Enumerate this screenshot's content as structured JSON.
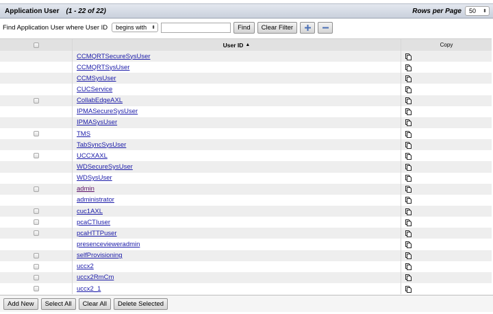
{
  "header": {
    "title": "Application User",
    "count": "(1 - 22 of 22)",
    "rows_per_page_label": "Rows per Page",
    "rows_per_page_value": "50"
  },
  "filter": {
    "label": "Find Application User where User ID",
    "match_value": "begins with",
    "search_value": "",
    "find_label": "Find",
    "clear_filter_label": "Clear Filter",
    "add_icon": "plus-icon",
    "remove_icon": "minus-icon"
  },
  "table": {
    "columns": {
      "user_id": "User ID",
      "sort_indicator": "▲",
      "copy": "Copy"
    },
    "rows": [
      {
        "user_id": "CCMQRTSecureSysUser",
        "checkbox": false,
        "visited": false
      },
      {
        "user_id": "CCMQRTSysUser",
        "checkbox": false,
        "visited": false
      },
      {
        "user_id": "CCMSysUser",
        "checkbox": false,
        "visited": false
      },
      {
        "user_id": "CUCService",
        "checkbox": false,
        "visited": false
      },
      {
        "user_id": "CollabEdgeAXL",
        "checkbox": true,
        "visited": false
      },
      {
        "user_id": "IPMASecureSysUser",
        "checkbox": false,
        "visited": false
      },
      {
        "user_id": "IPMASysUser",
        "checkbox": false,
        "visited": false
      },
      {
        "user_id": "TMS",
        "checkbox": true,
        "visited": false
      },
      {
        "user_id": "TabSyncSysUser",
        "checkbox": false,
        "visited": false
      },
      {
        "user_id": "UCCXAXL",
        "checkbox": true,
        "visited": false
      },
      {
        "user_id": "WDSecureSysUser",
        "checkbox": false,
        "visited": false
      },
      {
        "user_id": "WDSysUser",
        "checkbox": false,
        "visited": false
      },
      {
        "user_id": "admin",
        "checkbox": true,
        "visited": true
      },
      {
        "user_id": "administrator",
        "checkbox": false,
        "visited": false
      },
      {
        "user_id": "cuc1AXL",
        "checkbox": true,
        "visited": false
      },
      {
        "user_id": "pcaCTIuser",
        "checkbox": true,
        "visited": false
      },
      {
        "user_id": "pcaHTTPuser",
        "checkbox": true,
        "visited": false
      },
      {
        "user_id": "presencevieweradmin",
        "checkbox": false,
        "visited": false
      },
      {
        "user_id": "selfProvisioning",
        "checkbox": true,
        "visited": false
      },
      {
        "user_id": "uccx2",
        "checkbox": true,
        "visited": false
      },
      {
        "user_id": "uccx2RmCm",
        "checkbox": true,
        "visited": false
      },
      {
        "user_id": "uccx2_1",
        "checkbox": true,
        "visited": false
      }
    ]
  },
  "footer": {
    "add_new": "Add New",
    "select_all": "Select All",
    "clear_all": "Clear All",
    "delete_selected": "Delete Selected"
  },
  "colors": {
    "link": "#1a1aa8",
    "visited_link": "#5b0f68",
    "header_bg": "#c9d0dc"
  }
}
